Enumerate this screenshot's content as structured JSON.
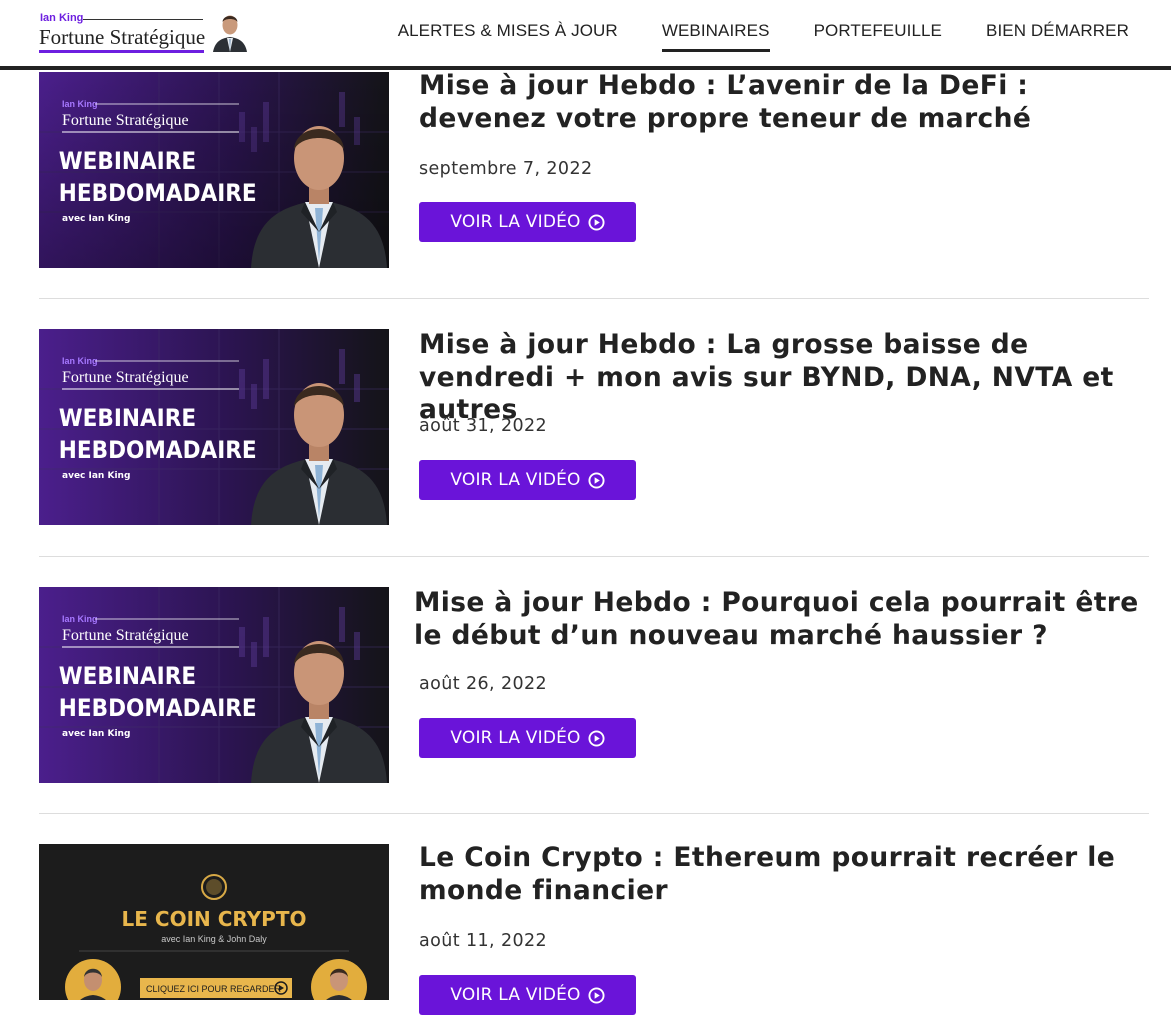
{
  "brand": {
    "small_name": "Ian King",
    "name": "Fortune Stratégique",
    "accent": "#6d1fe0"
  },
  "nav": {
    "items": [
      {
        "label": "ALERTES & MISES À JOUR"
      },
      {
        "label": "WEBINAIRES"
      },
      {
        "label": "PORTEFEUILLE"
      },
      {
        "label": "BIEN DÉMARRER"
      }
    ],
    "active": "WEBINAIRES"
  },
  "thumbnails": {
    "webinar": {
      "small_name": "Ian King",
      "brand": "Fortune Stratégique",
      "line1": "WEBINAIRE",
      "line2": "HEBDOMADAIRE",
      "byline": "avec Ian King"
    },
    "crypto": {
      "title": "LE COIN CRYPTO",
      "byline": "avec Ian King & John Daly",
      "cta": "CLIQUEZ ICI POUR REGARDER"
    }
  },
  "posts": [
    {
      "title": "Mise à jour Hebdo : L’avenir de la DeFi : devenez votre propre teneur de marché",
      "date": "septembre 7, 2022",
      "button": "VOIR LA VIDÉO"
    },
    {
      "title": "Mise à jour Hebdo : La grosse baisse de vendredi + mon avis sur BYND, DNA, NVTA et autres",
      "date": "août 31, 2022",
      "button": "VOIR LA VIDÉO"
    },
    {
      "title": "Mise à jour Hebdo : Pourquoi cela pourrait être le début d’un nouveau marché haussier ?",
      "date": "août 26, 2022",
      "button": "VOIR LA VIDÉO"
    },
    {
      "title": "Le Coin Crypto : Ethereum pourrait recréer le monde financier",
      "date": "août 11, 2022",
      "button": "VOIR LA VIDÉO"
    }
  ],
  "colors": {
    "button": "#6a14d9",
    "text": "#222222",
    "divider": "#dddddd"
  }
}
